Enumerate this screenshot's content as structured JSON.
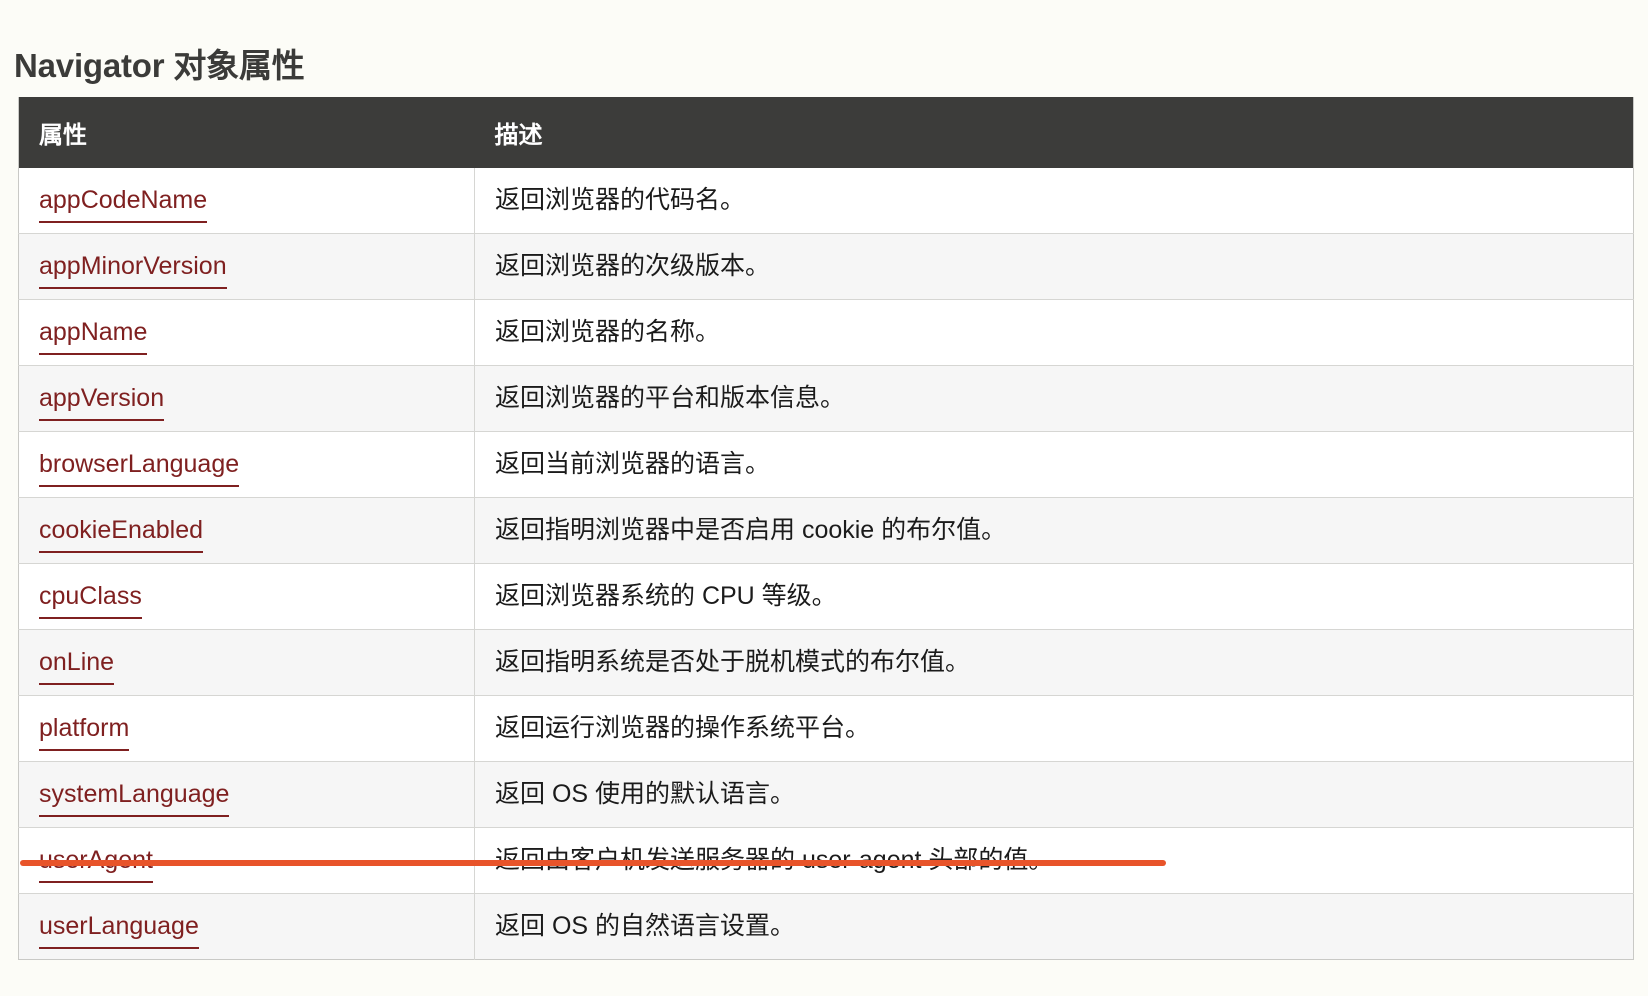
{
  "page": {
    "title": "Navigator 对象属性",
    "background_color": "#fcfcf7",
    "title_color": "#3b3b39"
  },
  "table": {
    "header_background": "#3c3c3a",
    "header_text_color": "#ffffff",
    "link_color": "#7f2020",
    "zebra_color": "#f6f6f6",
    "columns": [
      "属性",
      "描述"
    ],
    "rows": [
      {
        "property": "appCodeName",
        "description": "返回浏览器的代码名。"
      },
      {
        "property": "appMinorVersion",
        "description": "返回浏览器的次级版本。"
      },
      {
        "property": "appName",
        "description": "返回浏览器的名称。"
      },
      {
        "property": "appVersion",
        "description": "返回浏览器的平台和版本信息。"
      },
      {
        "property": "browserLanguage",
        "description": "返回当前浏览器的语言。"
      },
      {
        "property": "cookieEnabled",
        "description": "返回指明浏览器中是否启用 cookie 的布尔值。"
      },
      {
        "property": "cpuClass",
        "description": "返回浏览器系统的 CPU 等级。"
      },
      {
        "property": "onLine",
        "description": "返回指明系统是否处于脱机模式的布尔值。"
      },
      {
        "property": "platform",
        "description": "返回运行浏览器的操作系统平台。"
      },
      {
        "property": "systemLanguage",
        "description": "返回 OS 使用的默认语言。"
      },
      {
        "property": "userAgent",
        "description": "返回由客户机发送服务器的 user-agent 头部的值。"
      },
      {
        "property": "userLanguage",
        "description": "返回 OS 的自然语言设置。"
      }
    ]
  },
  "annotation": {
    "type": "underline-highlight",
    "color": "#e8542a",
    "target_row_property": "userAgent"
  }
}
